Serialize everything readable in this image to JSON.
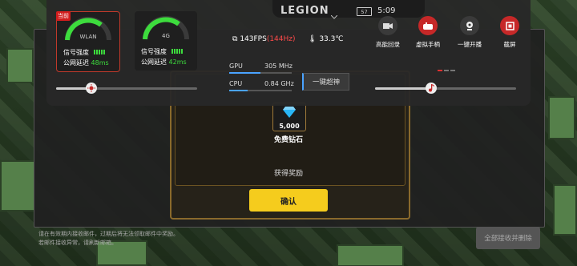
{
  "overlay": {
    "brand": "LEGION",
    "battery": "57",
    "clock": "5:09",
    "networks": [
      {
        "name": "WLAN",
        "current_badge": "当前",
        "signal_label": "信号强度",
        "latency_label": "公网延迟",
        "latency_value": "48ms"
      },
      {
        "name": "4G",
        "signal_label": "信号强度",
        "latency_label": "公网延迟",
        "latency_value": "42ms"
      }
    ],
    "fps": "143FPS",
    "refresh_rate": "(144Hz)",
    "temperature": "33.3℃",
    "gpu": {
      "label": "GPU",
      "value": "305 MHz",
      "level": 0.5
    },
    "cpu": {
      "label": "CPU",
      "value": "0.84 GHz",
      "level": 0.3
    },
    "boost_button": "一键超神",
    "brightness_level": 0.25,
    "volume_level": 0.4,
    "tools": [
      {
        "icon": "video-record-icon",
        "label": "高能回录",
        "color": "#3a3a3a"
      },
      {
        "icon": "gamepad-icon",
        "label": "虚拟手柄",
        "color": "#c62828"
      },
      {
        "icon": "webcam-icon",
        "label": "一键开播",
        "color": "#3a3a3a"
      },
      {
        "icon": "screenshot-icon",
        "label": "截屏",
        "color": "#c62828"
      }
    ]
  },
  "mail": {
    "gift_count": "5,000",
    "gift_label": "免费钻石",
    "reward_label": "获得奖励",
    "confirm_button": "确认",
    "notice_line1": "请在有效期内接收邮件，过期后将无法领取邮件中奖励。",
    "notice_line2": "若邮件接收异常，请刷新邮箱。",
    "delete_all_button": "全部接收并删除"
  }
}
